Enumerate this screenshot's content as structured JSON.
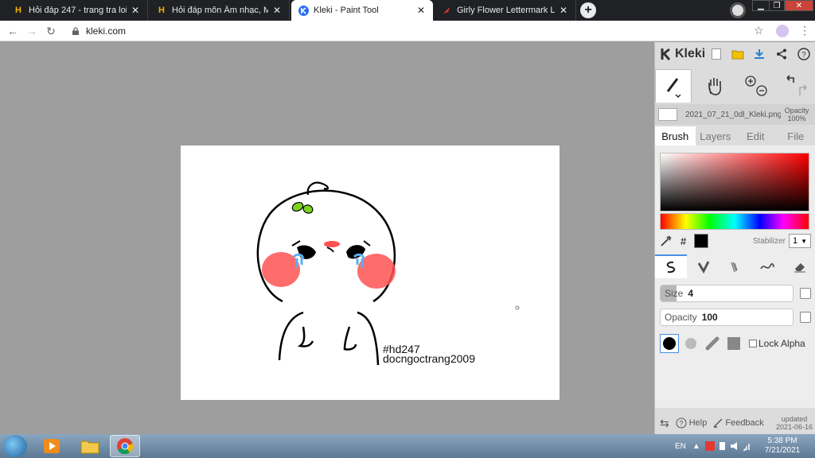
{
  "browser": {
    "tabs": [
      {
        "title": "Hỏi đáp 247 - trang tra loi",
        "icon": "h-logo-icon",
        "active": false
      },
      {
        "title": "Hỏi đáp môn Âm nhạc, Mỹ thuật",
        "icon": "h-logo-icon",
        "active": false
      },
      {
        "title": "Kleki - Paint Tool",
        "icon": "kleki-logo-icon",
        "active": true
      },
      {
        "title": "Girly Flower Lettermark Logo | Br",
        "icon": "red-logo-icon",
        "active": false
      }
    ],
    "close_glyph": "✕",
    "new_tab_glyph": "+",
    "url": "kleki.com"
  },
  "canvas": {
    "watermark_line1": "#hd247",
    "watermark_line2": "docngoctrang2009"
  },
  "kleki": {
    "logo_text": "Kleki",
    "file_name": "2021_07_21_0dl_Kleki.png",
    "opacity_label": "Opacity",
    "opacity_value": "100%",
    "tabs": [
      "Brush",
      "Layers",
      "Edit",
      "File"
    ],
    "active_tab": "Brush",
    "hash_glyph": "#",
    "current_color": "#000000",
    "stabilizer_label": "Stabilizer",
    "stabilizer_value": "1",
    "size_label": "Size",
    "size_value": "4",
    "size_fraction": 0.04,
    "opacity_slider_label": "Opacity",
    "opacity_slider_value": "100",
    "lock_alpha_label": "Lock Alpha",
    "help_label": "Help",
    "feedback_label": "Feedback",
    "updated_label": "updated",
    "updated_date": "2021-06-16"
  },
  "taskbar": {
    "language": "EN",
    "time": "5:38 PM",
    "date": "7/21/2021"
  },
  "colors": {
    "chrome_dark": "#202124",
    "panel_bg": "#dcdcdc",
    "accent_blue": "#4a90e2",
    "blush": "#ff4d4d",
    "tear_blue": "#5ab0f0",
    "sprout_green": "#7dd321"
  }
}
